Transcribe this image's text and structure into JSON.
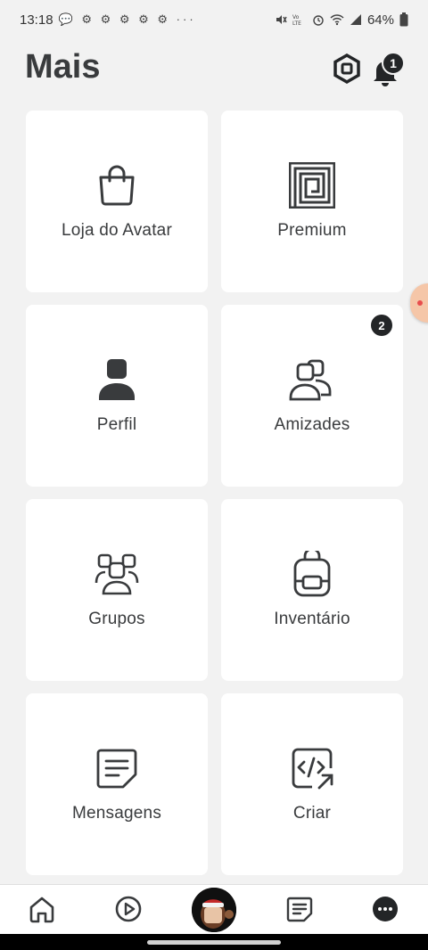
{
  "status_bar": {
    "time": "13:18",
    "battery": "64%"
  },
  "header": {
    "title": "Mais",
    "notification_count": "1"
  },
  "tiles": [
    {
      "label": "Loja do Avatar",
      "icon": "shopping-bag-icon"
    },
    {
      "label": "Premium",
      "icon": "premium-icon"
    },
    {
      "label": "Perfil",
      "icon": "person-icon"
    },
    {
      "label": "Amizades",
      "icon": "friends-icon",
      "badge": "2"
    },
    {
      "label": "Grupos",
      "icon": "groups-icon"
    },
    {
      "label": "Inventário",
      "icon": "backpack-icon"
    },
    {
      "label": "Mensagens",
      "icon": "message-icon"
    },
    {
      "label": "Criar",
      "icon": "create-code-icon"
    }
  ],
  "bottom_nav": {
    "items": [
      "home-icon",
      "play-icon",
      "avatar",
      "chat-icon",
      "more-icon"
    ]
  },
  "colors": {
    "background": "#f2f2f2",
    "tile": "#ffffff",
    "text": "#393b3d",
    "badge": "#232527"
  }
}
